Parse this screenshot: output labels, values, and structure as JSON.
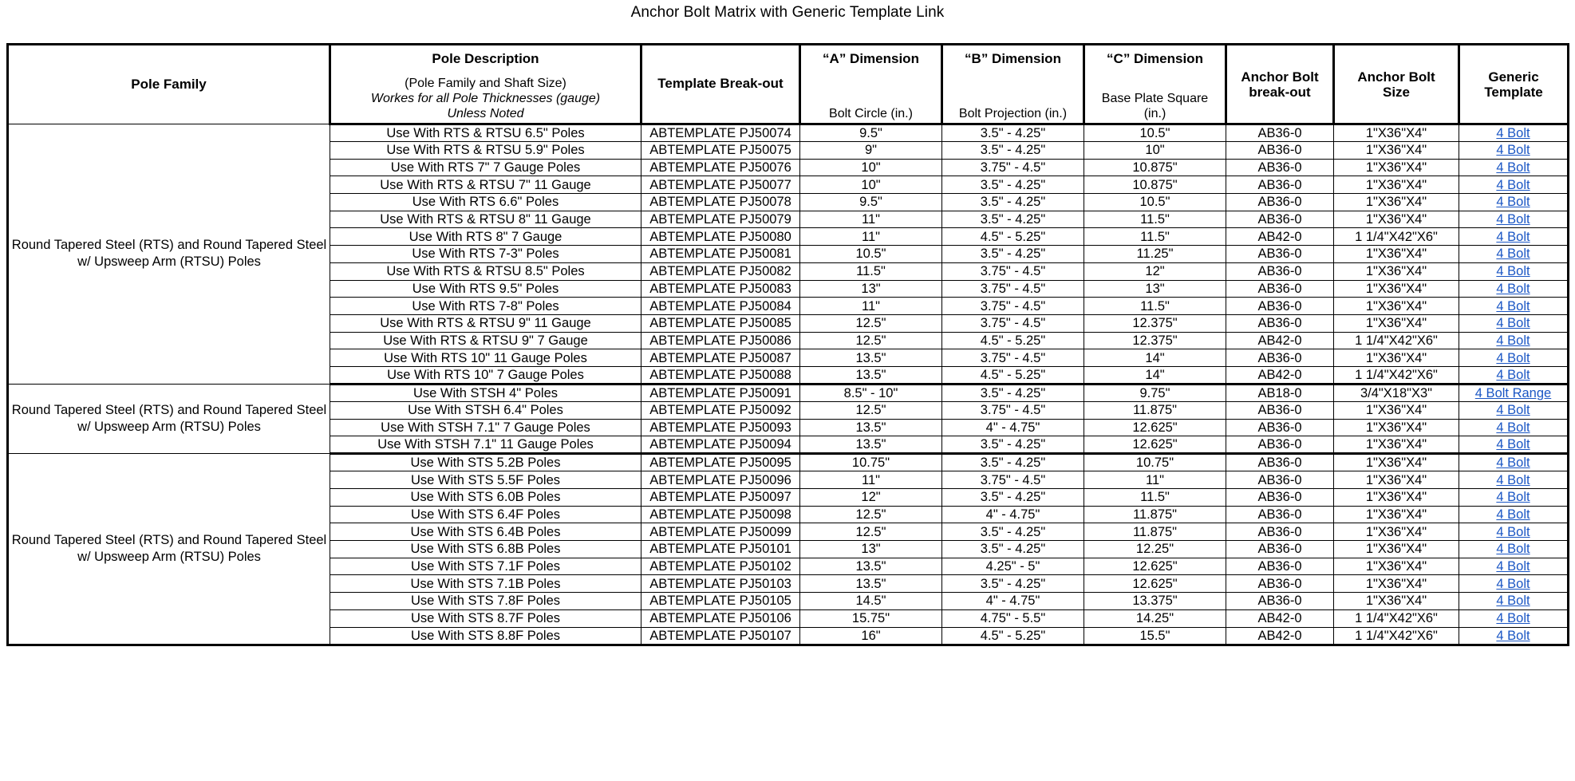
{
  "title": "Anchor Bolt Matrix with Generic Template Link",
  "headers": {
    "pole_family": "Pole Family",
    "pole_description_title": "Pole Description",
    "pole_description_sub1": "(Pole Family and Shaft Size)",
    "pole_description_sub2": "Workes for all Pole Thicknesses (gauge)",
    "pole_description_sub3": "Unless Noted",
    "template_breakout": "Template Break-out",
    "a_dim_title": "“A” Dimension",
    "a_dim_sub": "Bolt Circle (in.)",
    "b_dim_title": "“B” Dimension",
    "b_dim_sub": "Bolt Projection (in.)",
    "c_dim_title": "“C” Dimension",
    "c_dim_sub1": "Base Plate Square",
    "c_dim_sub2": "(in.)",
    "anchor_bolt_breakout_l1": "Anchor Bolt",
    "anchor_bolt_breakout_l2": "break-out",
    "anchor_bolt_size_l1": "Anchor Bolt",
    "anchor_bolt_size_l2": "Size",
    "generic_template_l1": "Generic",
    "generic_template_l2": "Template"
  },
  "link_color": "#1a56c4",
  "groups": [
    {
      "family": "Round Tapered Steel (RTS) and Round Tapered Steel w/ Upsweep Arm (RTSU) Poles",
      "rows": [
        {
          "desc": "Use With RTS & RTSU 6.5\" Poles",
          "template": "ABTEMPLATE PJ50074",
          "a": "9.5\"",
          "b": "3.5\" - 4.25\"",
          "c": "10.5\"",
          "ab": "AB36-0",
          "size": "1\"X36\"X4\"",
          "generic": "4 Bolt"
        },
        {
          "desc": "Use With RTS & RTSU 5.9\" Poles",
          "template": "ABTEMPLATE PJ50075",
          "a": "9\"",
          "b": "3.5\" - 4.25\"",
          "c": "10\"",
          "ab": "AB36-0",
          "size": "1\"X36\"X4\"",
          "generic": "4 Bolt"
        },
        {
          "desc": "Use With RTS 7\" 7 Gauge Poles",
          "template": "ABTEMPLATE PJ50076",
          "a": "10\"",
          "b": "3.75\" - 4.5\"",
          "c": "10.875\"",
          "ab": "AB36-0",
          "size": "1\"X36\"X4\"",
          "generic": "4 Bolt"
        },
        {
          "desc": "Use With RTS & RTSU 7\" 11 Gauge",
          "template": "ABTEMPLATE PJ50077",
          "a": "10\"",
          "b": "3.5\" - 4.25\"",
          "c": "10.875\"",
          "ab": "AB36-0",
          "size": "1\"X36\"X4\"",
          "generic": "4 Bolt"
        },
        {
          "desc": "Use With RTS 6.6\" Poles",
          "template": "ABTEMPLATE PJ50078",
          "a": "9.5\"",
          "b": "3.5\" - 4.25\"",
          "c": "10.5\"",
          "ab": "AB36-0",
          "size": "1\"X36\"X4\"",
          "generic": "4 Bolt"
        },
        {
          "desc": "Use With RTS & RTSU 8\" 11 Gauge",
          "template": "ABTEMPLATE PJ50079",
          "a": "11\"",
          "b": "3.5\" - 4.25\"",
          "c": "11.5\"",
          "ab": "AB36-0",
          "size": "1\"X36\"X4\"",
          "generic": "4 Bolt"
        },
        {
          "desc": "Use With RTS 8\" 7 Gauge",
          "template": "ABTEMPLATE PJ50080",
          "a": "11\"",
          "b": "4.5\" - 5.25\"",
          "c": "11.5\"",
          "ab": "AB42-0",
          "size": "1 1/4\"X42\"X6\"",
          "generic": "4 Bolt"
        },
        {
          "desc": "Use With RTS 7-3\" Poles",
          "template": "ABTEMPLATE PJ50081",
          "a": "10.5\"",
          "b": "3.5\" - 4.25\"",
          "c": "11.25\"",
          "ab": "AB36-0",
          "size": "1\"X36\"X4\"",
          "generic": "4 Bolt"
        },
        {
          "desc": "Use With RTS & RTSU 8.5\" Poles",
          "template": "ABTEMPLATE PJ50082",
          "a": "11.5\"",
          "b": "3.75\" - 4.5\"",
          "c": "12\"",
          "ab": "AB36-0",
          "size": "1\"X36\"X4\"",
          "generic": "4 Bolt"
        },
        {
          "desc": "Use With RTS 9.5\" Poles",
          "template": "ABTEMPLATE PJ50083",
          "a": "13\"",
          "b": "3.75\" - 4.5\"",
          "c": "13\"",
          "ab": "AB36-0",
          "size": "1\"X36\"X4\"",
          "generic": "4 Bolt"
        },
        {
          "desc": "Use With RTS 7-8\" Poles",
          "template": "ABTEMPLATE PJ50084",
          "a": "11\"",
          "b": "3.75\" - 4.5\"",
          "c": "11.5\"",
          "ab": "AB36-0",
          "size": "1\"X36\"X4\"",
          "generic": "4 Bolt"
        },
        {
          "desc": "Use With RTS & RTSU 9\" 11 Gauge",
          "template": "ABTEMPLATE PJ50085",
          "a": "12.5\"",
          "b": "3.75\" - 4.5\"",
          "c": "12.375\"",
          "ab": "AB36-0",
          "size": "1\"X36\"X4\"",
          "generic": "4 Bolt"
        },
        {
          "desc": "Use With RTS & RTSU 9\" 7 Gauge",
          "template": "ABTEMPLATE PJ50086",
          "a": "12.5\"",
          "b": "4.5\" - 5.25\"",
          "c": "12.375\"",
          "ab": "AB42-0",
          "size": "1 1/4\"X42\"X6\"",
          "generic": "4 Bolt"
        },
        {
          "desc": "Use With RTS 10\" 11 Gauge Poles",
          "template": "ABTEMPLATE PJ50087",
          "a": "13.5\"",
          "b": "3.75\" - 4.5\"",
          "c": "14\"",
          "ab": "AB36-0",
          "size": "1\"X36\"X4\"",
          "generic": "4 Bolt"
        },
        {
          "desc": "Use With RTS 10\" 7 Gauge Poles",
          "template": "ABTEMPLATE PJ50088",
          "a": "13.5\"",
          "b": "4.5\" - 5.25\"",
          "c": "14\"",
          "ab": "AB42-0",
          "size": "1 1/4\"X42\"X6\"",
          "generic": "4 Bolt"
        }
      ]
    },
    {
      "family": "Round Tapered Steel (RTS) and Round Tapered Steel w/ Upsweep Arm (RTSU) Poles",
      "rows": [
        {
          "desc": "Use With STSH 4\" Poles",
          "template": "ABTEMPLATE PJ50091",
          "a": "8.5\" - 10\"",
          "b": "3.5\" - 4.25\"",
          "c": "9.75\"",
          "ab": "AB18-0",
          "size": "3/4\"X18\"X3\"",
          "generic": "4 Bolt Range"
        },
        {
          "desc": "Use With STSH 6.4\" Poles",
          "template": "ABTEMPLATE PJ50092",
          "a": "12.5\"",
          "b": "3.75\" - 4.5\"",
          "c": "11.875\"",
          "ab": "AB36-0",
          "size": "1\"X36\"X4\"",
          "generic": "4 Bolt"
        },
        {
          "desc": "Use With STSH 7.1\" 7 Gauge Poles",
          "template": "ABTEMPLATE PJ50093",
          "a": "13.5\"",
          "b": "4\" - 4.75\"",
          "c": "12.625\"",
          "ab": "AB36-0",
          "size": "1\"X36\"X4\"",
          "generic": "4 Bolt"
        },
        {
          "desc": "Use With STSH 7.1\" 11 Gauge Poles",
          "template": "ABTEMPLATE PJ50094",
          "a": "13.5\"",
          "b": "3.5\" - 4.25\"",
          "c": "12.625\"",
          "ab": "AB36-0",
          "size": "1\"X36\"X4\"",
          "generic": "4 Bolt"
        }
      ]
    },
    {
      "family": "Round Tapered Steel (RTS) and Round Tapered Steel w/ Upsweep Arm (RTSU) Poles",
      "rows": [
        {
          "desc": "Use With STS 5.2B Poles",
          "template": "ABTEMPLATE PJ50095",
          "a": "10.75\"",
          "b": "3.5\" - 4.25\"",
          "c": "10.75\"",
          "ab": "AB36-0",
          "size": "1\"X36\"X4\"",
          "generic": "4 Bolt"
        },
        {
          "desc": "Use With STS 5.5F Poles",
          "template": "ABTEMPLATE PJ50096",
          "a": "11\"",
          "b": "3.75\" - 4.5\"",
          "c": "11\"",
          "ab": "AB36-0",
          "size": "1\"X36\"X4\"",
          "generic": "4 Bolt"
        },
        {
          "desc": "Use With STS 6.0B Poles",
          "template": "ABTEMPLATE PJ50097",
          "a": "12\"",
          "b": "3.5\" - 4.25\"",
          "c": "11.5\"",
          "ab": "AB36-0",
          "size": "1\"X36\"X4\"",
          "generic": "4 Bolt"
        },
        {
          "desc": "Use With STS 6.4F Poles",
          "template": "ABTEMPLATE PJ50098",
          "a": "12.5\"",
          "b": "4\" - 4.75\"",
          "c": "11.875\"",
          "ab": "AB36-0",
          "size": "1\"X36\"X4\"",
          "generic": "4 Bolt"
        },
        {
          "desc": "Use With STS 6.4B Poles",
          "template": "ABTEMPLATE PJ50099",
          "a": "12.5\"",
          "b": "3.5\" - 4.25\"",
          "c": "11.875\"",
          "ab": "AB36-0",
          "size": "1\"X36\"X4\"",
          "generic": "4 Bolt"
        },
        {
          "desc": "Use With STS 6.8B Poles",
          "template": "ABTEMPLATE PJ50101",
          "a": "13\"",
          "b": "3.5\" - 4.25\"",
          "c": "12.25\"",
          "ab": "AB36-0",
          "size": "1\"X36\"X4\"",
          "generic": "4 Bolt"
        },
        {
          "desc": "Use With STS 7.1F Poles",
          "template": "ABTEMPLATE PJ50102",
          "a": "13.5\"",
          "b": "4.25\" - 5\"",
          "c": "12.625\"",
          "ab": "AB36-0",
          "size": "1\"X36\"X4\"",
          "generic": "4 Bolt"
        },
        {
          "desc": "Use With STS 7.1B Poles",
          "template": "ABTEMPLATE PJ50103",
          "a": "13.5\"",
          "b": "3.5\" - 4.25\"",
          "c": "12.625\"",
          "ab": "AB36-0",
          "size": "1\"X36\"X4\"",
          "generic": "4 Bolt"
        },
        {
          "desc": "Use With STS 7.8F Poles",
          "template": "ABTEMPLATE PJ50105",
          "a": "14.5\"",
          "b": "4\" - 4.75\"",
          "c": "13.375\"",
          "ab": "AB36-0",
          "size": "1\"X36\"X4\"",
          "generic": "4 Bolt"
        },
        {
          "desc": "Use With STS 8.7F Poles",
          "template": "ABTEMPLATE PJ50106",
          "a": "15.75\"",
          "b": "4.75\" - 5.5\"",
          "c": "14.25\"",
          "ab": "AB42-0",
          "size": "1 1/4\"X42\"X6\"",
          "generic": "4 Bolt"
        },
        {
          "desc": "Use With STS 8.8F Poles",
          "template": "ABTEMPLATE PJ50107",
          "a": "16\"",
          "b": "4.5\" - 5.25\"",
          "c": "15.5\"",
          "ab": "AB42-0",
          "size": "1 1/4\"X42\"X6\"",
          "generic": "4 Bolt"
        }
      ]
    }
  ]
}
